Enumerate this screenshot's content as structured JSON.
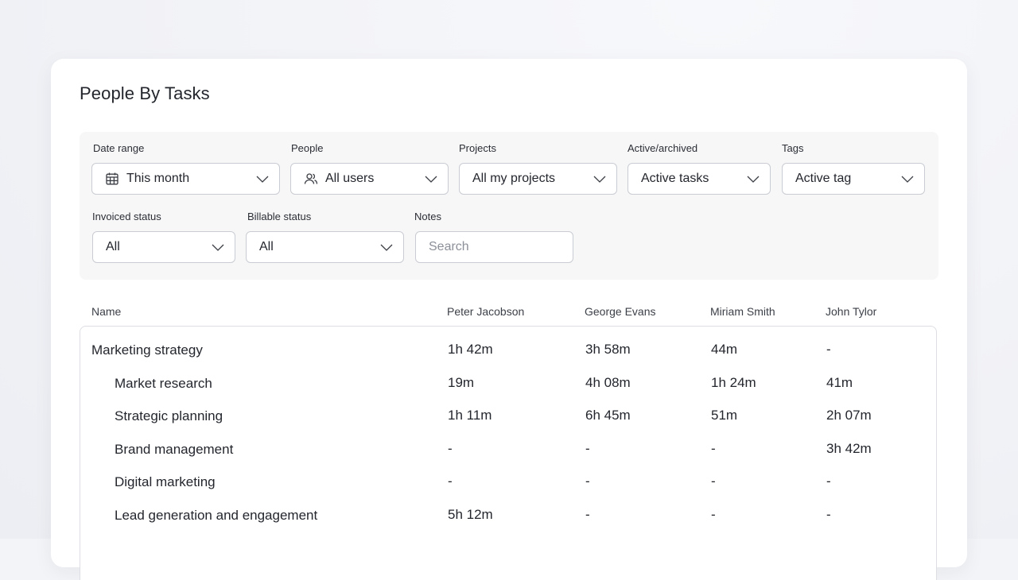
{
  "page": {
    "title": "People By Tasks"
  },
  "filters": {
    "date_range": {
      "label": "Date range",
      "value": "This month",
      "icon": "calendar-icon"
    },
    "people": {
      "label": "People",
      "value": "All users",
      "icon": "users-icon"
    },
    "projects": {
      "label": "Projects",
      "value": "All my projects"
    },
    "active_archived": {
      "label": "Active/archived",
      "value": "Active tasks"
    },
    "tags": {
      "label": "Tags",
      "value": "Active tag"
    },
    "invoiced_status": {
      "label": "Invoiced status",
      "value": "All"
    },
    "billable_status": {
      "label": "Billable status",
      "value": "All"
    },
    "notes": {
      "label": "Notes",
      "placeholder": "Search",
      "value": ""
    }
  },
  "table": {
    "columns": [
      "Name",
      "Peter Jacobson",
      "George Evans",
      "Miriam Smith",
      "John Tylor"
    ],
    "rows": [
      {
        "name": "Marketing strategy",
        "level": 0,
        "values": [
          "1h 42m",
          "3h 58m",
          "44m",
          "-"
        ]
      },
      {
        "name": "Market research",
        "level": 1,
        "values": [
          "19m",
          "4h 08m",
          "1h 24m",
          "41m"
        ]
      },
      {
        "name": "Strategic planning",
        "level": 1,
        "values": [
          "1h 11m",
          "6h 45m",
          "51m",
          "2h 07m"
        ]
      },
      {
        "name": "Brand management",
        "level": 1,
        "values": [
          "-",
          "-",
          "-",
          "3h 42m"
        ]
      },
      {
        "name": "Digital marketing",
        "level": 1,
        "values": [
          "-",
          "-",
          "-",
          "-"
        ]
      },
      {
        "name": "Lead generation and engagement",
        "level": 1,
        "values": [
          "5h 12m",
          "-",
          "-",
          "-"
        ]
      }
    ]
  },
  "colors": {
    "card": "#ffffff",
    "filter_panel": "#f7f7f8",
    "border": "#c9ccd2",
    "text": "#23262d"
  }
}
